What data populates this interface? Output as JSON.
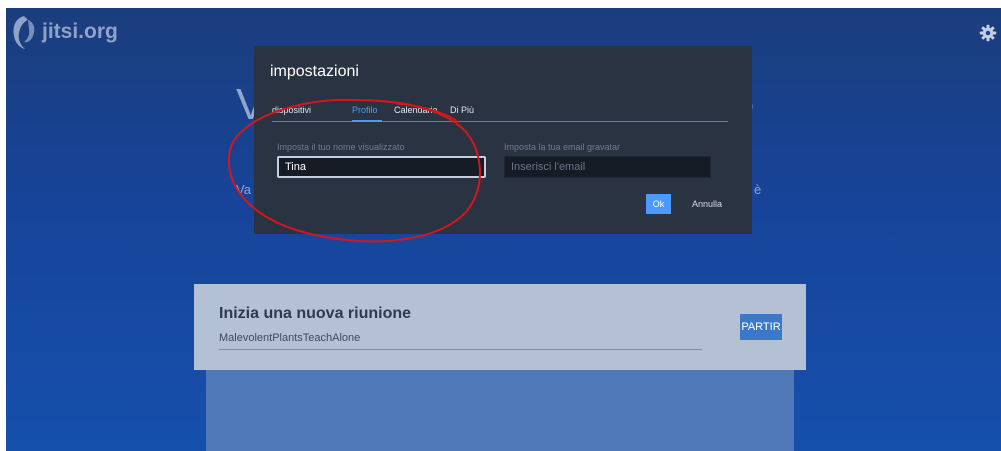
{
  "brand": {
    "logo_text": "jitsi.org"
  },
  "background_page": {
    "hero_title_left": "V",
    "hero_title_right": "e",
    "hero_sub_left": "Va",
    "hero_sub_right": "è",
    "meeting_card": {
      "title": "Inizia una nuova riunione",
      "room_name": "MalevolentPlantsTeachAlone",
      "start_button": "PARTIR"
    }
  },
  "settings_dialog": {
    "title": "impostazioni",
    "tabs": [
      {
        "label": "dispositivi",
        "active": false
      },
      {
        "label": "Profilo",
        "active": true
      },
      {
        "label": "Calendario",
        "active": false
      },
      {
        "label": "Di Più",
        "active": false
      }
    ],
    "display_name": {
      "label": "Imposta il tuo nome visualizzato",
      "value": "Tina"
    },
    "email": {
      "label": "Imposta la tua email gravatar",
      "placeholder": "Inserisci l'email",
      "value": ""
    },
    "ok_button": "Ok",
    "cancel_button": "Annulla"
  },
  "colors": {
    "accent": "#4c9aff",
    "dialog_bg": "#2a3341",
    "page_bg": "#17449a",
    "annotation_stroke": "#d8151b"
  },
  "icons": {
    "logo": "jitsi-logo-icon",
    "settings": "gear-icon"
  }
}
